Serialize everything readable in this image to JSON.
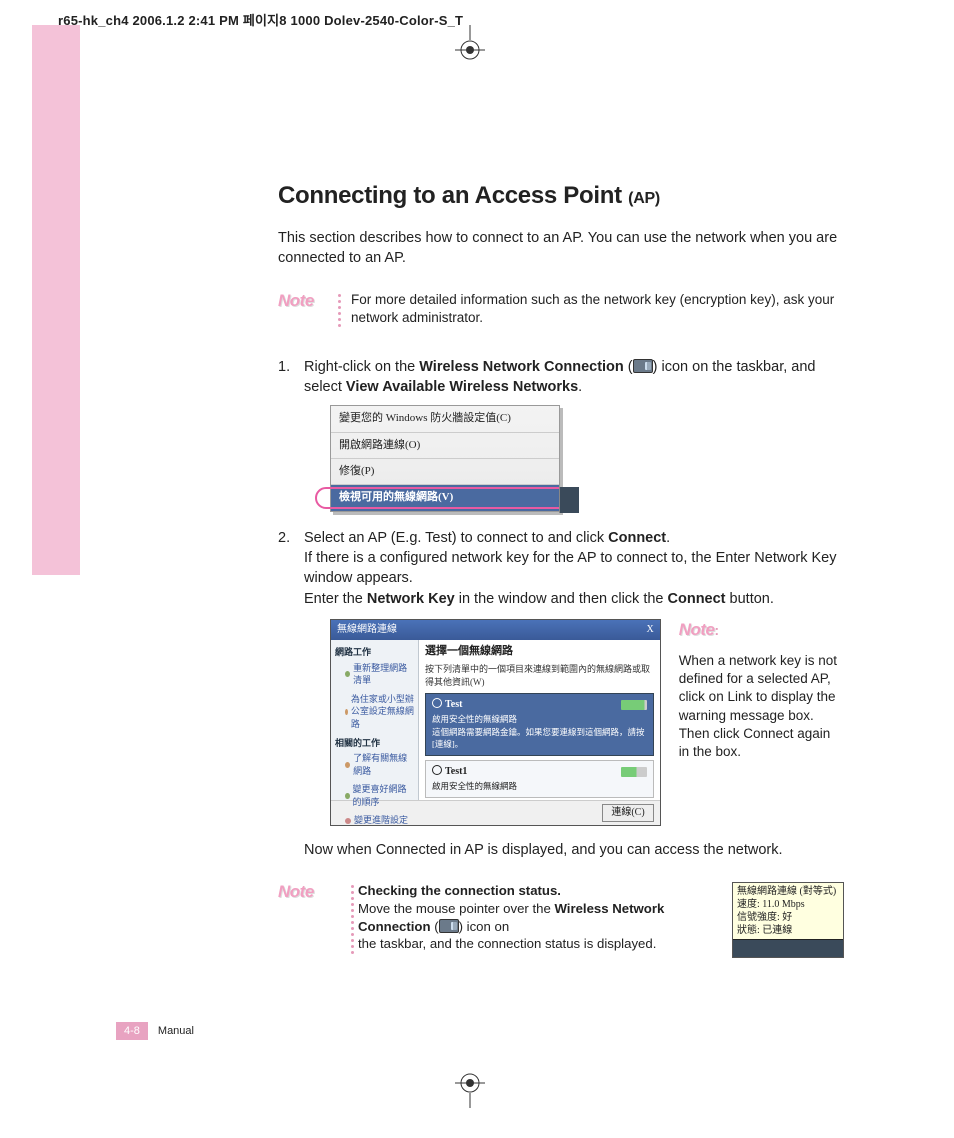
{
  "header": "r65-hk_ch4  2006.1.2 2:41 PM  페이지8   1000 Dolev-2540-Color-S_T",
  "title_main": "Connecting to an Access Point",
  "title_sub": "(AP)",
  "intro": "This section describes how to connect to an AP. You can use the network when you are connected to an AP.",
  "note1": {
    "badge": "Note",
    "text": "For more detailed information such as the network key (encryption key), ask your network administrator."
  },
  "step1": {
    "num": "1.",
    "pre": "Right-click on the ",
    "b1": "Wireless Network Connection",
    "mid": " (",
    "post": ") icon on the taskbar, and select ",
    "b2": "View Available Wireless Networks",
    "end": "."
  },
  "menu": {
    "r1": "變更您的 Windows 防火牆設定值(C)",
    "r2": "開啟網路連線(O)",
    "r3": "修復(P)",
    "r4": "檢視可用的無線網路(V)"
  },
  "step2": {
    "num": "2.",
    "l1a": "Select an AP (E.g. Test) to connect to and click ",
    "l1b": "Connect",
    "l1c": ".",
    "l2": "If there is a configured network key for the AP to connect to, the Enter Network Key window appears.",
    "l3a": "Enter the ",
    "l3b": "Network Key",
    "l3c": " in the window and then click the ",
    "l3d": "Connect",
    "l3e": " button."
  },
  "dialog": {
    "title": "無線網路連線",
    "close": "X",
    "side_hdr1": "網路工作",
    "side_l1": "重新整理網路清單",
    "side_l2": "為住家或小型辦公室設定無線網路",
    "side_hdr2": "相關的工作",
    "side_l3": "了解有關無線網路",
    "side_l4": "變更喜好網路的順序",
    "side_l5": "變更進階設定",
    "main_hdr": "選擇一個無線網路",
    "main_sub": "按下列清單中的一個項目來連線到範圍內的無線網路或取得其他資訊(W)",
    "ap1_name": "Test",
    "ap1_desc1": "啟用安全性的無線網路",
    "ap1_desc2": "這個網路需要網路金鑰。如果您要連線到這個網路，請按 [連線]。",
    "ap2_name": "Test1",
    "ap2_desc": "啟用安全性的無線網路",
    "btn": "連線(C)"
  },
  "side_note": {
    "badge": "Note",
    "dots": ":",
    "text": "When a network key is not defined for a selected AP, click on Link to display the warning message box. Then click Connect again in the box."
  },
  "after": "Now when Connected in AP is displayed, and you can access the network.",
  "note3": {
    "badge": "Note",
    "b1": "Checking the connection status.",
    "l1": "Move the mouse pointer over the ",
    "b2": "Wireless Network Connection",
    "mid": " (",
    "post": ") icon on",
    "l3": "the taskbar, and the connection status is displayed."
  },
  "tooltip": {
    "l1": "無線網路連線 (對等式)",
    "l2": "速度: 11.0 Mbps",
    "l3": "信號強度: 好",
    "l4": "狀態: 已連線"
  },
  "footer": {
    "page": "4-8",
    "label": "Manual"
  }
}
